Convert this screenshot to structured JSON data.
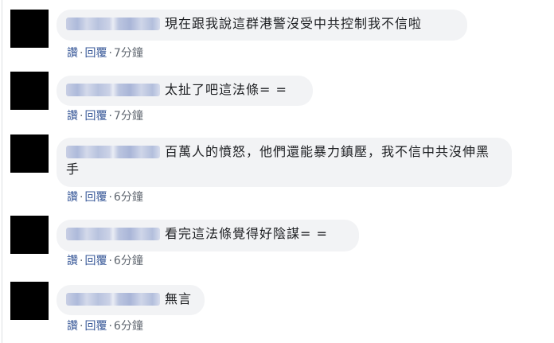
{
  "comments": [
    {
      "text": "現在跟我說這群港警沒受中共控制我不信啦",
      "like_label": "讚",
      "reply_label": "回覆",
      "time": "7分鐘"
    },
    {
      "text": "太扯了吧這法條= =",
      "like_label": "讚",
      "reply_label": "回覆",
      "time": "7分鐘"
    },
    {
      "text": "百萬人的憤怒，他們還能暴力鎮壓，我不信中共沒伸黑手",
      "like_label": "讚",
      "reply_label": "回覆",
      "time": "6分鐘"
    },
    {
      "text": "看完這法條覺得好陰謀= =",
      "like_label": "讚",
      "reply_label": "回覆",
      "time": "6分鐘"
    },
    {
      "text": "無言",
      "like_label": "讚",
      "reply_label": "回覆",
      "time": "6分鐘"
    }
  ],
  "separator": "·",
  "colors": {
    "bubble": "#f2f3f5",
    "link": "#385898",
    "meta": "#606770",
    "avatar": "#000000"
  }
}
